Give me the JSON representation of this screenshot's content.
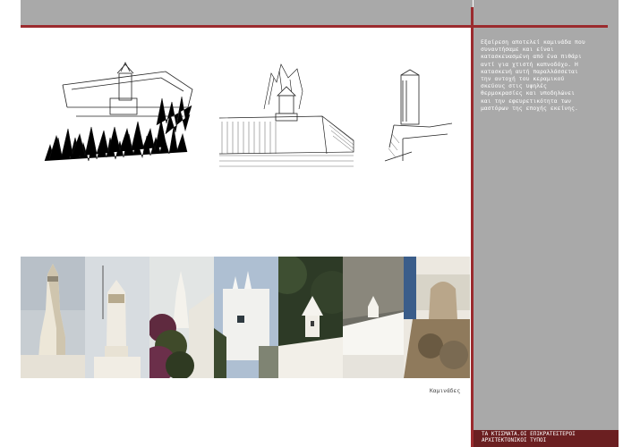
{
  "sidebar": {
    "description": "Εξαίρεση αποτελεί καμινάδα που\nσυναντήσαμε και είναι\nκατασκευασμένη από ένα πιθάρι\nαντί για χτιστή καπνοδόχο. Η\nκατασκευή αυτή παραλλάσσεται\nτην αντοχή του κεραμικού\nσκεύους στις υψηλές\nθερμοκρασίες και υποδηλώνει\nκαι την εφευρετικότητα των\nμαστόρων της εποχής εκείνης.",
    "footer": "ΤΑ ΚΤΙΣΜΑΤΑ.ΟΙ ΕΠΙΚΡΑΤΕΣΤΕΡΟΙ\nΑΡΧΙΤΕΚΤΟΝΙΚΟΙ ΤΥΠΟΙ"
  },
  "figures": {
    "caption": "Καμινάδες"
  },
  "colors": {
    "accent": "#9b2b2e",
    "sidebar": "#a9a9a9",
    "footer": "#6b1f21"
  }
}
